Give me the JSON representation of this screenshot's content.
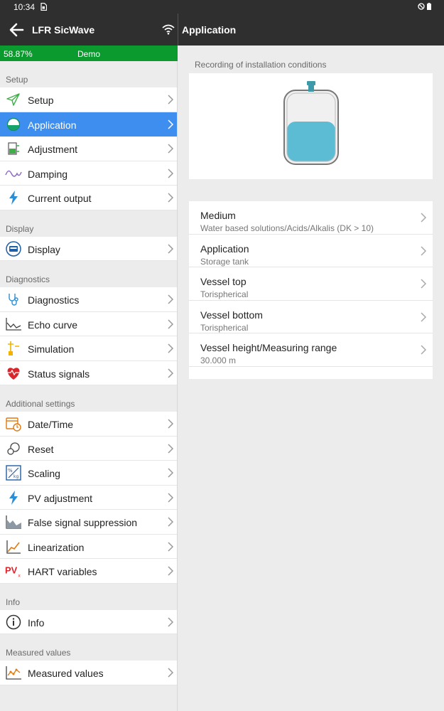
{
  "status_bar": {
    "time": "10:34"
  },
  "header": {
    "device_title": "LFR SicWave",
    "page_title": "Application"
  },
  "progress": {
    "percent_text": "58.87%",
    "value_percent": 58.87,
    "mode": "Demo"
  },
  "sidebar": {
    "sections": [
      {
        "title": "Setup",
        "items": [
          {
            "label": "Setup",
            "icon": "send-icon"
          },
          {
            "label": "Application",
            "icon": "tank-icon",
            "active": true
          },
          {
            "label": "Adjustment",
            "icon": "adjustment-icon"
          },
          {
            "label": "Damping",
            "icon": "wave-icon"
          },
          {
            "label": "Current output",
            "icon": "lightning-icon"
          }
        ]
      },
      {
        "title": "Display",
        "items": [
          {
            "label": "Display",
            "icon": "display-icon"
          }
        ]
      },
      {
        "title": "Diagnostics",
        "items": [
          {
            "label": "Diagnostics",
            "icon": "stethoscope-icon"
          },
          {
            "label": "Echo curve",
            "icon": "echo-curve-icon"
          },
          {
            "label": "Simulation",
            "icon": "simulation-icon"
          },
          {
            "label": "Status signals",
            "icon": "heartbeat-icon"
          }
        ]
      },
      {
        "title": "Additional settings",
        "items": [
          {
            "label": "Date/Time",
            "icon": "calendar-clock-icon"
          },
          {
            "label": "Reset",
            "icon": "reset-icon"
          },
          {
            "label": "Scaling",
            "icon": "scaling-icon"
          },
          {
            "label": "PV adjustment",
            "icon": "lightning-icon"
          },
          {
            "label": "False signal suppression",
            "icon": "false-signal-icon"
          },
          {
            "label": "Linearization",
            "icon": "linearization-icon"
          },
          {
            "label": "HART variables",
            "icon": "pv-icon"
          }
        ]
      },
      {
        "title": "Info",
        "items": [
          {
            "label": "Info",
            "icon": "info-icon"
          }
        ]
      },
      {
        "title": "Measured values",
        "items": [
          {
            "label": "Measured values",
            "icon": "measured-values-icon"
          }
        ]
      }
    ]
  },
  "content": {
    "caption": "Recording of installation conditions",
    "tank_fill_fraction": 0.5,
    "parameters": [
      {
        "name": "Medium",
        "value": "Water based solutions/Acids/Alkalis (DK > 10)"
      },
      {
        "name": "Application",
        "value": "Storage tank"
      },
      {
        "name": "Vessel top",
        "value": "Torispherical"
      },
      {
        "name": "Vessel bottom",
        "value": "Torispherical"
      },
      {
        "name": "Vessel height/Measuring range",
        "value": "30.000 m"
      }
    ]
  },
  "colors": {
    "appbar": "#2f2f2f",
    "progress": "#0b9a2e",
    "active": "#3e8ef0",
    "tank_liquid": "#5bbcd3"
  }
}
